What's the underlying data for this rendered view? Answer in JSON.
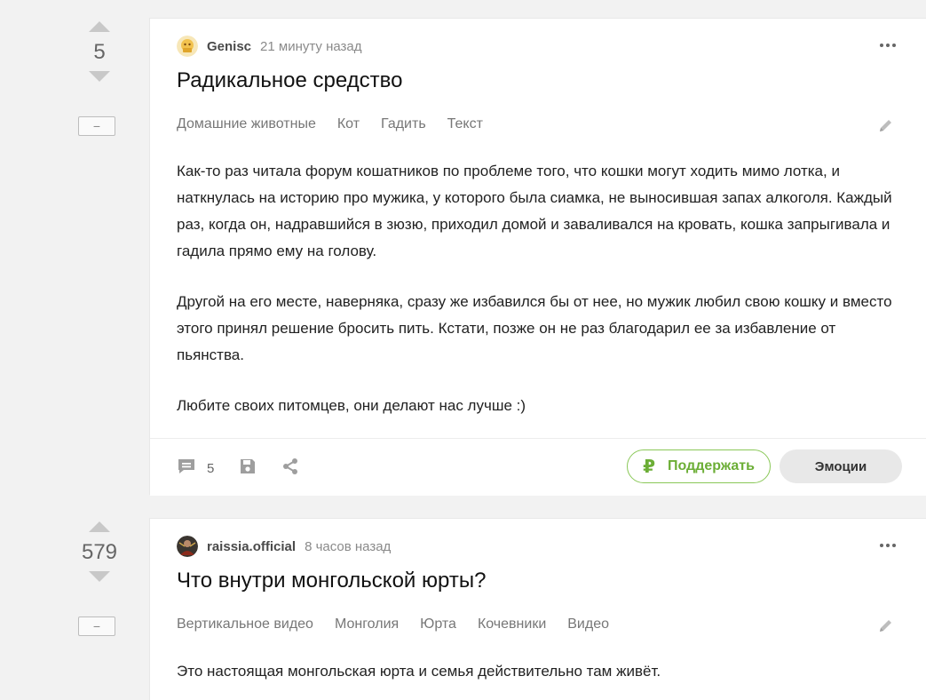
{
  "posts": [
    {
      "rating": "5",
      "collapse_label": "−",
      "author": "Genisc",
      "time": "21 минуту назад",
      "title": "Радикальное средство",
      "tags": [
        "Домашние животные",
        "Кот",
        "Гадить",
        "Текст"
      ],
      "paragraphs": [
        "Как-то раз читала форум кошатников по проблеме того, что кошки могут ходить мимо лотка, и наткнулась на историю про мужика, у которого была сиамка, не выносившая запах алкоголя. Каждый раз, когда он, надравшийся в зюзю, приходил домой и заваливался на кровать, кошка запрыгивала и гадила прямо ему на голову.",
        "Другой на его месте, наверняка, сразу же избавился бы от нее, но мужик любил свою кошку и вместо этого принял решение бросить пить. Кстати, позже он не раз благодарил ее за избавление от пьянства.",
        "Любите своих питомцев, они делают нас лучше :)"
      ],
      "comments_count": "5",
      "support_label": "Поддержать",
      "emotions_label": "Эмоции"
    },
    {
      "rating": "579",
      "collapse_label": "−",
      "author": "raissia.official",
      "time": "8 часов назад",
      "title": "Что внутри монгольской юрты?",
      "tags": [
        "Вертикальное видео",
        "Монголия",
        "Юрта",
        "Кочевники",
        "Видео"
      ],
      "paragraphs": [
        "Это настоящая монгольская юрта и семья действительно там живёт."
      ]
    }
  ],
  "colors": {
    "background": "#f2f2f2",
    "card": "#ffffff",
    "support_green": "#6cae36",
    "vote_arrow": "#c8c8c8"
  },
  "icons": {
    "vote_up": "triangle-up-icon",
    "vote_down": "triangle-down-icon",
    "more": "ellipsis-icon",
    "edit": "pencil-icon",
    "comments": "comment-icon",
    "save": "floppy-disk-icon",
    "share": "share-icon",
    "support": "ruble-icon"
  }
}
